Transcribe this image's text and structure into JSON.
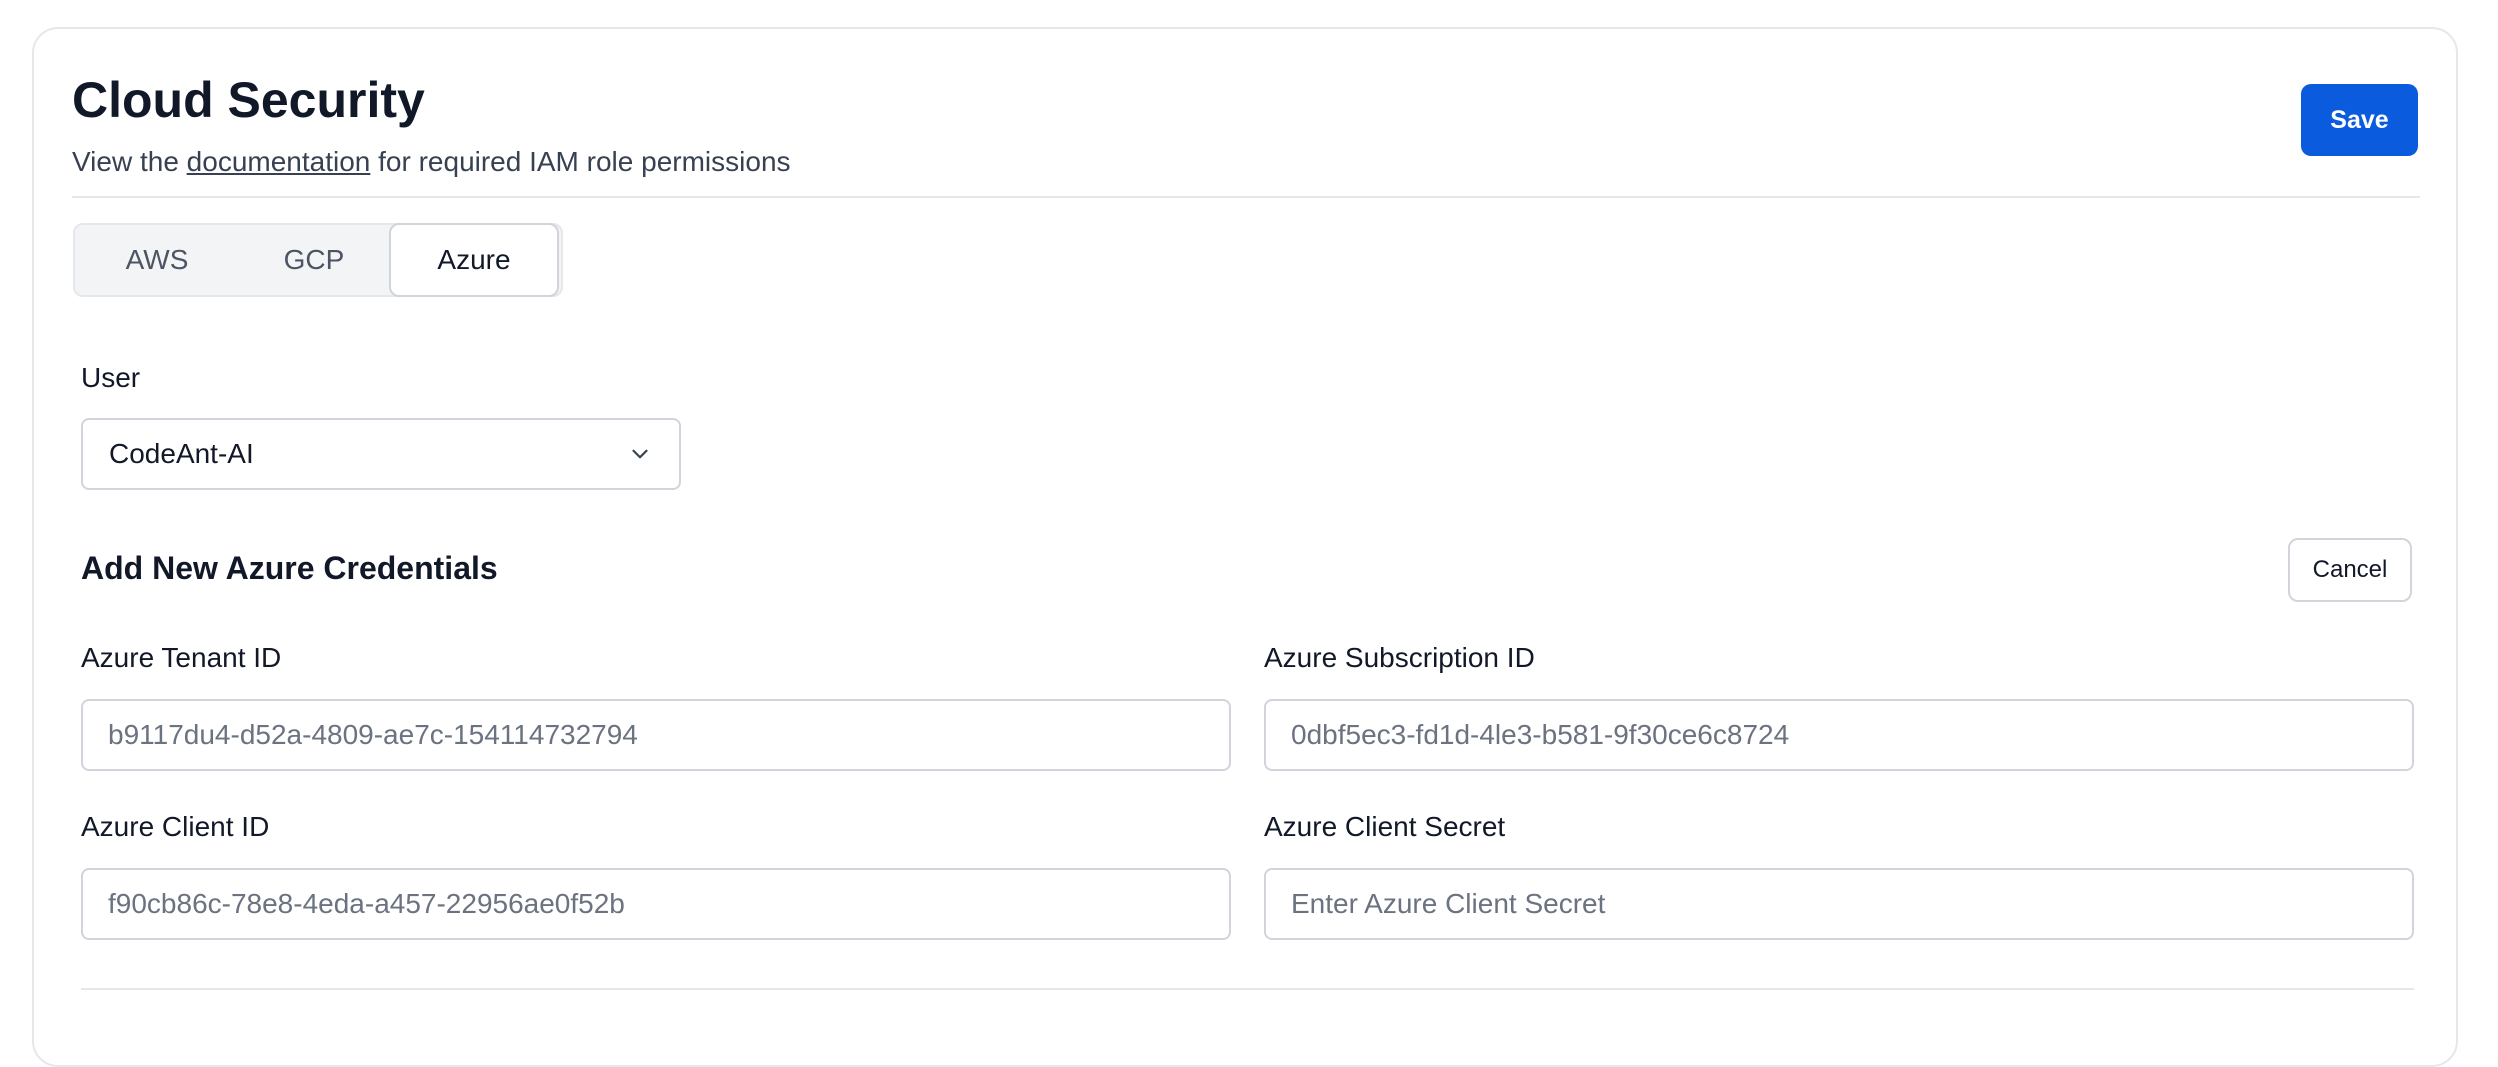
{
  "header": {
    "title": "Cloud Security",
    "subtitle_prefix": "View the ",
    "subtitle_link": "documentation",
    "subtitle_suffix": " for required IAM role permissions",
    "save_label": "Save"
  },
  "tabs": [
    {
      "label": "AWS",
      "active": false
    },
    {
      "label": "GCP",
      "active": false
    },
    {
      "label": "Azure",
      "active": true
    }
  ],
  "user": {
    "label": "User",
    "selected": "CodeAnt-AI",
    "icon": "chevron-down-icon"
  },
  "form": {
    "title": "Add New Azure Credentials",
    "cancel_label": "Cancel",
    "fields": {
      "tenant_id": {
        "label": "Azure Tenant ID",
        "value": "b9117du4-d52a-4809-ae7c-154114732794",
        "placeholder": ""
      },
      "subscription_id": {
        "label": "Azure Subscription ID",
        "value": "0dbf5ec3-fd1d-4le3-b581-9f30ce6c8724",
        "placeholder": ""
      },
      "client_id": {
        "label": "Azure Client ID",
        "value": "f90cb86c-78e8-4eda-a457-22956ae0f52b",
        "placeholder": ""
      },
      "client_secret": {
        "label": "Azure Client Secret",
        "value": "",
        "placeholder": "Enter Azure Client Secret"
      }
    }
  },
  "colors": {
    "primary": "#0b5bdf",
    "border": "#d1d5db",
    "divider": "#e5e7eb"
  }
}
